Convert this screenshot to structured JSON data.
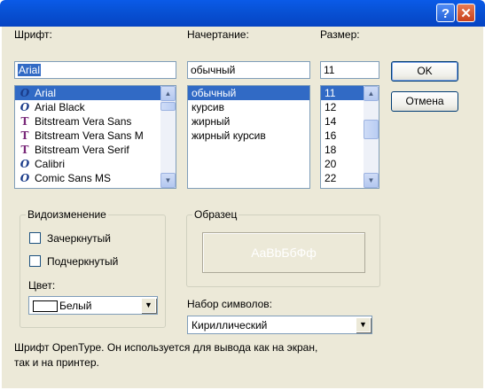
{
  "titlebar": {
    "help_label": "?",
    "close_label": "✕"
  },
  "font": {
    "label": "Шрифт:",
    "value": "Arial",
    "items": [
      {
        "name": "Arial",
        "icon": "opentype-icon"
      },
      {
        "name": "Arial Black",
        "icon": "opentype-icon"
      },
      {
        "name": "Bitstream Vera Sans",
        "icon": "truetype-icon"
      },
      {
        "name": "Bitstream Vera Sans M",
        "icon": "truetype-icon"
      },
      {
        "name": "Bitstream Vera Serif",
        "icon": "truetype-icon"
      },
      {
        "name": "Calibri",
        "icon": "opentype-icon"
      },
      {
        "name": "Comic Sans MS",
        "icon": "opentype-icon"
      }
    ]
  },
  "style": {
    "label": "Начертание:",
    "value": "обычный",
    "items": [
      "обычный",
      "курсив",
      "жирный",
      "жирный курсив"
    ]
  },
  "size": {
    "label": "Размер:",
    "value": "11",
    "items": [
      "11",
      "12",
      "14",
      "16",
      "18",
      "20",
      "22"
    ]
  },
  "buttons": {
    "ok": "OK",
    "cancel": "Отмена"
  },
  "effects": {
    "title": "Видоизменение",
    "strikeout": "Зачеркнутый",
    "underline": "Подчеркнутый",
    "color_label": "Цвет:",
    "color_value": "Белый"
  },
  "sample": {
    "title": "Образец",
    "text": "AaBbБбФф"
  },
  "charset": {
    "label": "Набор символов:",
    "value": "Кириллический"
  },
  "description": {
    "line1": "Шрифт OpenType. Он используется для вывода как на экран,",
    "line2": "так и на принтер."
  },
  "colors": {
    "title_bar": "#0852d6",
    "selection": "#316ac5",
    "dialog_bg": "#ece9d8"
  }
}
